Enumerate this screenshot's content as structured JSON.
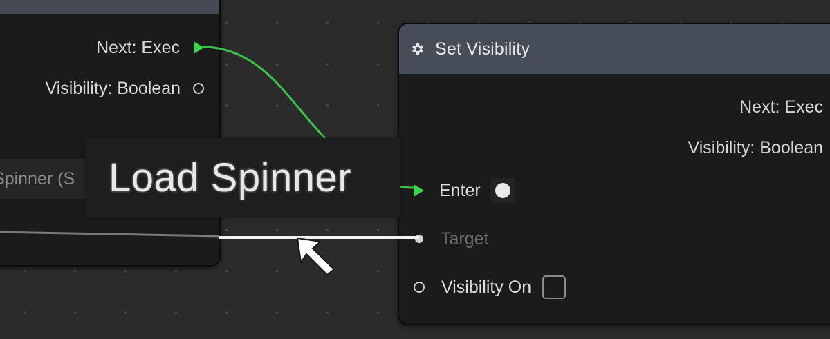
{
  "canvas": {
    "background": "#2b2b2b",
    "accent_exec": "#3bd44a"
  },
  "left_node": {
    "outputs": [
      {
        "label": "Next: Exec",
        "pin": "exec-pin-icon"
      },
      {
        "label": "Visibility: Boolean",
        "pin": "ring-pin-icon"
      }
    ],
    "input_field": "Spinner (S"
  },
  "set_visibility_node": {
    "title": "Set Visibility",
    "title_icon": "gear-icon",
    "outputs": [
      {
        "label": "Next: Exec"
      },
      {
        "label": "Visibility: Boolean"
      }
    ],
    "inputs": [
      {
        "label": "Enter",
        "pin": "exec-pin-icon"
      },
      {
        "label": "Target",
        "pin": "dot-pin-icon"
      },
      {
        "label": "Visibility On",
        "pin": "ring-pin-icon"
      }
    ]
  },
  "tooltip": {
    "text": "Load Spinner"
  },
  "cursor": {
    "icon": "arrow-cursor-icon"
  }
}
